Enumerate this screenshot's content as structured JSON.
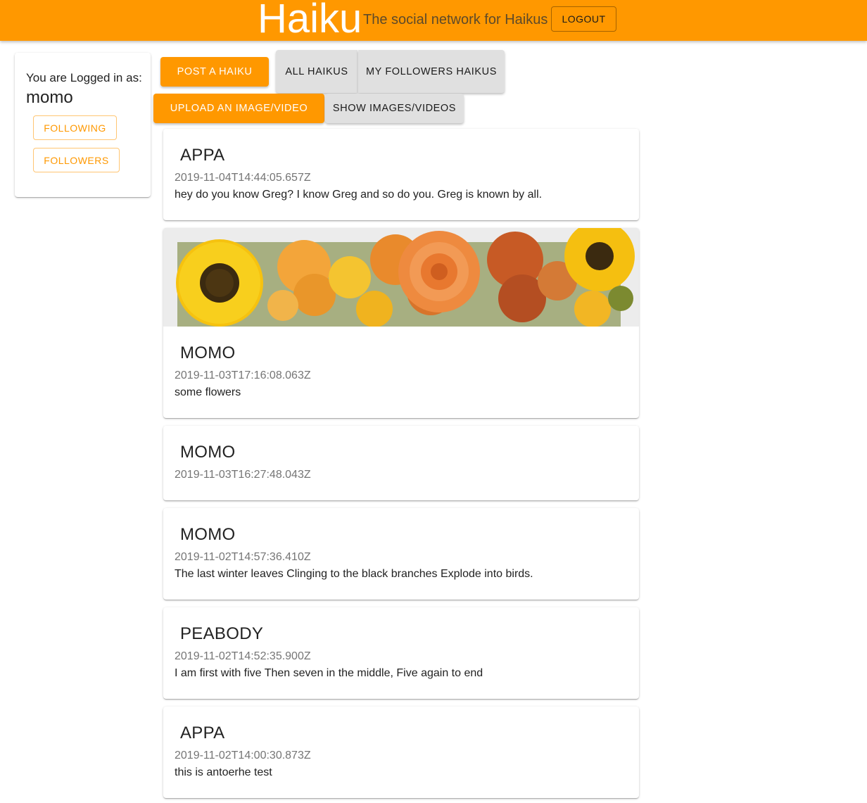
{
  "header": {
    "brand": "Haiku",
    "tagline": "The social network for Haikus",
    "logout_label": "LOGOUT"
  },
  "sidebar": {
    "logged_in_label": "You are Logged in as:",
    "username": "momo",
    "following_label": "FOLLOWING",
    "followers_label": "FOLLOWERS"
  },
  "actions": {
    "post_label": "POST A HAIKU",
    "all_label": "ALL HAIKUS",
    "followers_haikus_label": "MY FOLLOWERS HAIKUS",
    "upload_label": "UPLOAD AN IMAGE/VIDEO",
    "show_media_label": "SHOW IMAGES/VIDEOS"
  },
  "posts": [
    {
      "author": "APPA",
      "date": "2019-11-04T14:44:05.657Z",
      "text": "hey do you know Greg? I know Greg and so do you. Greg is known by all."
    },
    {
      "author": "MOMO",
      "date": "2019-11-03T17:16:08.063Z",
      "text": "some flowers",
      "media": "flower-bouquet-image"
    },
    {
      "author": "MOMO",
      "date": "2019-11-03T16:27:48.043Z",
      "text": ""
    },
    {
      "author": "MOMO",
      "date": "2019-11-02T14:57:36.410Z",
      "text": "The last winter leaves Clinging to the black branches Explode into birds."
    },
    {
      "author": "PEABODY",
      "date": "2019-11-02T14:52:35.900Z",
      "text": "I am first with five Then seven in the middle, Five again to end"
    },
    {
      "author": "APPA",
      "date": "2019-11-02T14:00:30.873Z",
      "text": "this is antoerhe test"
    }
  ],
  "colors": {
    "accent": "#ff9800",
    "grey_button": "#e0e0e0",
    "date_text": "#757575"
  }
}
